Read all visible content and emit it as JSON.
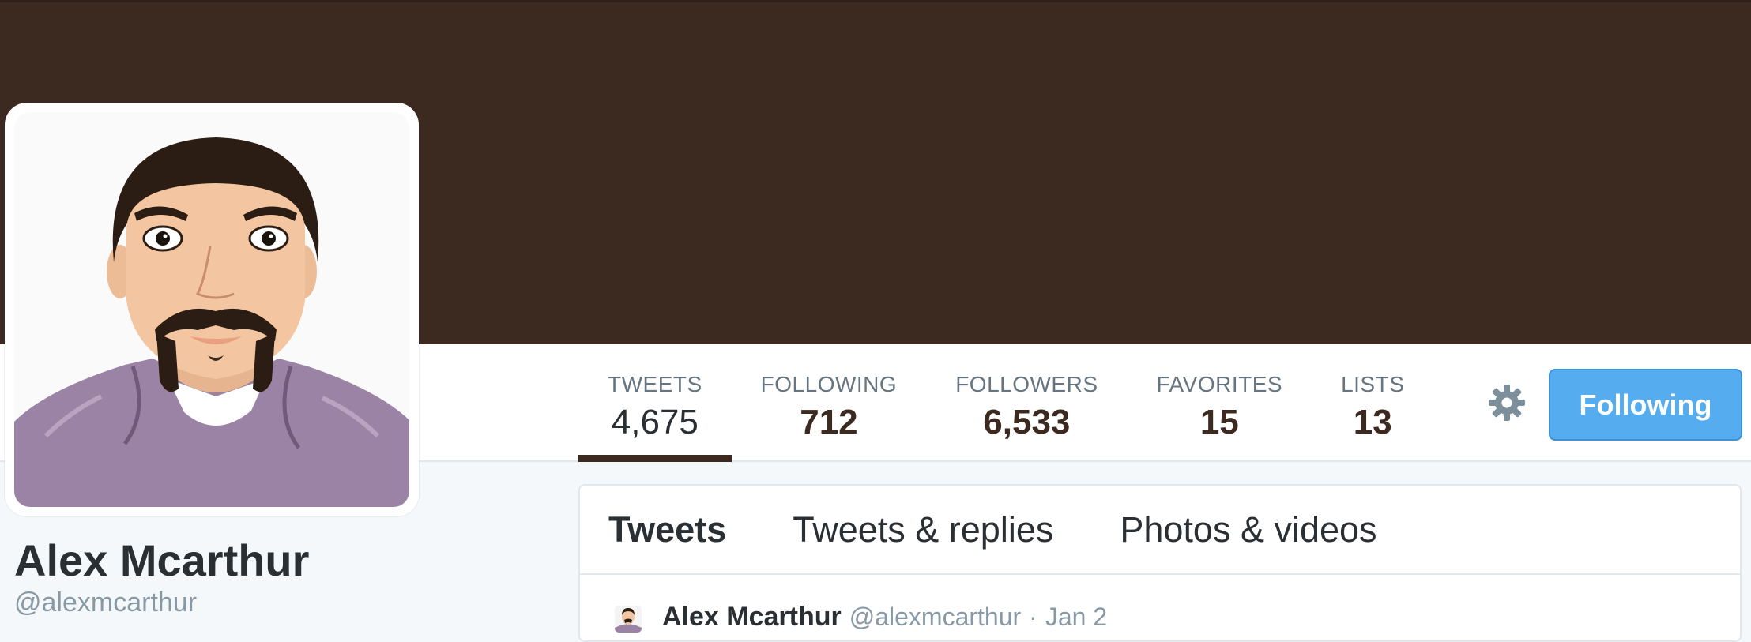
{
  "colors": {
    "banner": "#3c2a21",
    "accent": "#3c2a21",
    "button": "#55acee"
  },
  "nav": {
    "stats": [
      {
        "label": "TWEETS",
        "value": "4,675"
      },
      {
        "label": "FOLLOWING",
        "value": "712"
      },
      {
        "label": "FOLLOWERS",
        "value": "6,533"
      },
      {
        "label": "FAVORITES",
        "value": "15"
      },
      {
        "label": "LISTS",
        "value": "13"
      }
    ],
    "settings_icon": "gear-icon",
    "follow_button": "Following"
  },
  "profile": {
    "name": "Alex Mcarthur",
    "handle": "@alexmcarthur"
  },
  "timeline": {
    "tabs": [
      "Tweets",
      "Tweets & replies",
      "Photos & videos"
    ],
    "first_tweet": {
      "name": "Alex Mcarthur",
      "handle": "@alexmcarthur",
      "separator": "·",
      "time": "Jan 2"
    }
  }
}
